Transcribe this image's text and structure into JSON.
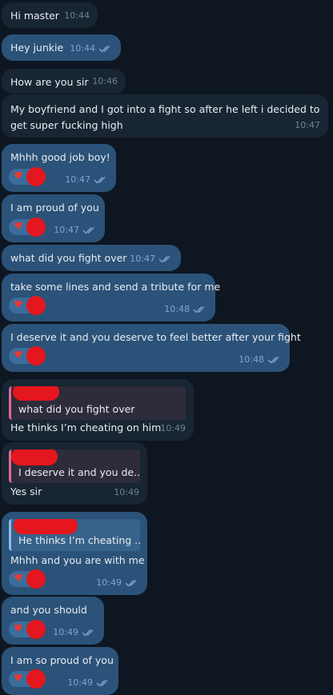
{
  "colors": {
    "background": "#0e1621",
    "incoming_bubble": "#182533",
    "outgoing_bubble": "#2b5278",
    "read_check": "#7da8d3",
    "reaction_heart": "#e53935",
    "redaction": "#e4161e",
    "reply_accent_incoming": "#e56598"
  },
  "messages": [
    {
      "text": "Hi master",
      "time": "10:44"
    },
    {
      "text": "Hey junkie",
      "time": "10:44"
    },
    {
      "text": "How are you sir",
      "time": "10:46"
    },
    {
      "text": "My boyfriend and I got into a fight so after he left i decided to get super fucking high",
      "time": "10:47"
    },
    {
      "text": "Mhhh good job boy!",
      "time": "10:47",
      "reaction": "heart-icon"
    },
    {
      "text": "I am proud of you",
      "time": "10:47",
      "reaction": "heart-icon"
    },
    {
      "text": "what did you fight over",
      "time": "10:47"
    },
    {
      "text": "take some lines and send a tribute for me",
      "time": "10:48",
      "reaction": "heart-icon"
    },
    {
      "text": "I deserve it and you deserve to feel better after your fight",
      "time": "10:48",
      "reaction": "heart-icon"
    },
    {
      "reply_to": "what did you fight over",
      "text": "He thinks I’m cheating on him",
      "time": "10:49"
    },
    {
      "reply_to": "I deserve it and you de...",
      "text": "Yes sir",
      "time": "10:49"
    },
    {
      "reply_to": "He thinks I’m cheating ...",
      "text": "Mhhh and you are with me",
      "time": "10:49",
      "reaction": "heart-icon"
    },
    {
      "text": "and you should",
      "time": "10:49",
      "reaction": "heart-icon"
    },
    {
      "text": "I am so proud of you",
      "time": "10:49",
      "reaction": "heart-icon"
    }
  ]
}
